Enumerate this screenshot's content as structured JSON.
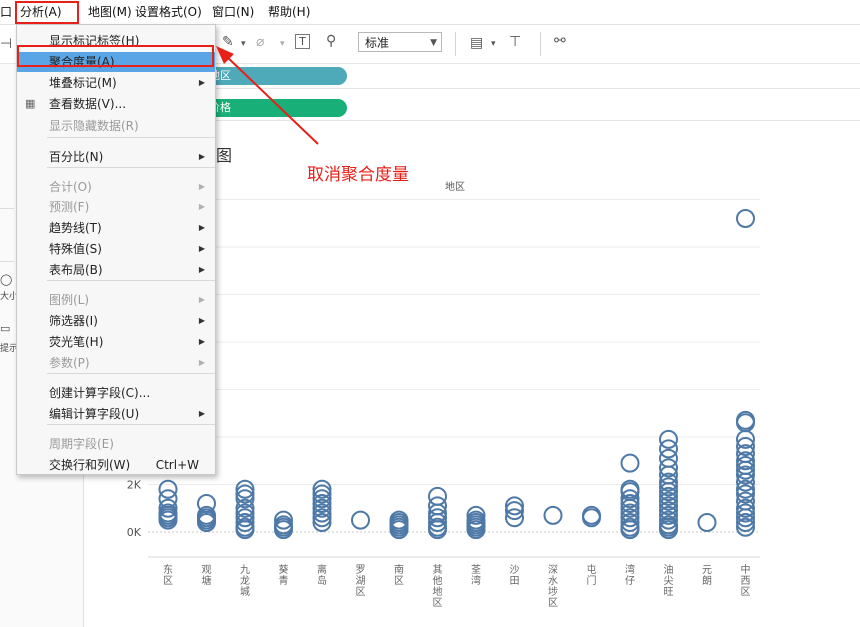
{
  "menubar": {
    "items": [
      "口",
      "分析(A)",
      "地图(M)",
      "设置格式(O)",
      "窗口(N)",
      "帮助(H)"
    ]
  },
  "toolbar": {
    "mark_size_select": "标准"
  },
  "shelves": {
    "columns_pill": "地区",
    "rows_pill": "价格"
  },
  "leftpane": {
    "size_label": "大小",
    "tooltip_label": "提示"
  },
  "dropdown": {
    "items": [
      {
        "label": "显示标记标签(H)",
        "enabled": true,
        "submenu": false
      },
      {
        "label": "聚合度量(A)",
        "enabled": true,
        "submenu": false,
        "highlighted": true
      },
      {
        "label": "堆叠标记(M)",
        "enabled": true,
        "submenu": true
      },
      {
        "label": "查看数据(V)...",
        "enabled": true,
        "submenu": false
      },
      {
        "label": "显示隐藏数据(R)",
        "enabled": false,
        "submenu": false
      },
      {
        "label": "百分比(N)",
        "enabled": true,
        "submenu": true
      },
      {
        "label": "合计(O)",
        "enabled": false,
        "submenu": true
      },
      {
        "label": "预测(F)",
        "enabled": false,
        "submenu": true
      },
      {
        "label": "趋势线(T)",
        "enabled": true,
        "submenu": true
      },
      {
        "label": "特殊值(S)",
        "enabled": true,
        "submenu": true
      },
      {
        "label": "表布局(B)",
        "enabled": true,
        "submenu": true
      },
      {
        "label": "图例(L)",
        "enabled": false,
        "submenu": true
      },
      {
        "label": "筛选器(I)",
        "enabled": true,
        "submenu": true
      },
      {
        "label": "荧光笔(H)",
        "enabled": true,
        "submenu": true
      },
      {
        "label": "参数(P)",
        "enabled": false,
        "submenu": true
      },
      {
        "label": "创建计算字段(C)...",
        "enabled": true,
        "submenu": false
      },
      {
        "label": "编辑计算字段(U)",
        "enabled": true,
        "submenu": true
      },
      {
        "label": "周期字段(E)",
        "enabled": false,
        "submenu": false
      },
      {
        "label": "交换行和列(W)",
        "enabled": true,
        "submenu": false,
        "shortcut": "Ctrl+W"
      }
    ]
  },
  "annotation": {
    "text": "取消聚合度量",
    "color": "#e8201a"
  },
  "worksheet": {
    "title_fragment": "图"
  },
  "chart_data": {
    "type": "scatter",
    "xlabel": "地区",
    "ylabel": "",
    "y_tick_labels": [
      "0K",
      "2K"
    ],
    "ylim": [
      -500,
      14500
    ],
    "grid": true,
    "marker": "open-circle",
    "color": "#4e79a7",
    "categories": [
      "东区",
      "观塘",
      "九龙城",
      "葵青",
      "离岛",
      "罗湖区",
      "南区",
      "其他地区",
      "荃湾",
      "沙田",
      "深水埗区",
      "屯门",
      "湾仔",
      "油尖旺",
      "元朗",
      "中西区"
    ],
    "series": [
      {
        "values": [
          [
            1800,
            1400,
            1000,
            800,
            700,
            600,
            500
          ],
          [
            1200,
            700,
            600,
            500,
            400
          ],
          [
            1800,
            1600,
            1400,
            1000,
            800,
            600,
            400,
            200,
            100
          ],
          [
            500,
            300,
            200,
            100
          ],
          [
            1800,
            1600,
            1400,
            1200,
            1000,
            800,
            600,
            400
          ],
          [
            500
          ],
          [
            500,
            400,
            300,
            200,
            100
          ],
          [
            1500,
            1100,
            800,
            600,
            400,
            200,
            100
          ],
          [
            700,
            500,
            400,
            300,
            200,
            100
          ],
          [
            1100,
            900,
            600
          ],
          [
            700
          ],
          [
            700,
            600
          ],
          [
            2900,
            1800,
            1700,
            1400,
            1200,
            1000,
            800,
            600,
            400,
            200,
            100
          ],
          [
            3900,
            3500,
            3100,
            2700,
            2400,
            2100,
            1900,
            1700,
            1500,
            1300,
            1100,
            900,
            700,
            500,
            300,
            200,
            100
          ],
          [
            400
          ],
          [
            13200,
            4700,
            4600,
            3900,
            3600,
            3300,
            3000,
            2800,
            2600,
            2400,
            2100,
            1800,
            1600,
            1300,
            1000,
            800,
            600,
            400,
            200
          ]
        ]
      }
    ]
  }
}
